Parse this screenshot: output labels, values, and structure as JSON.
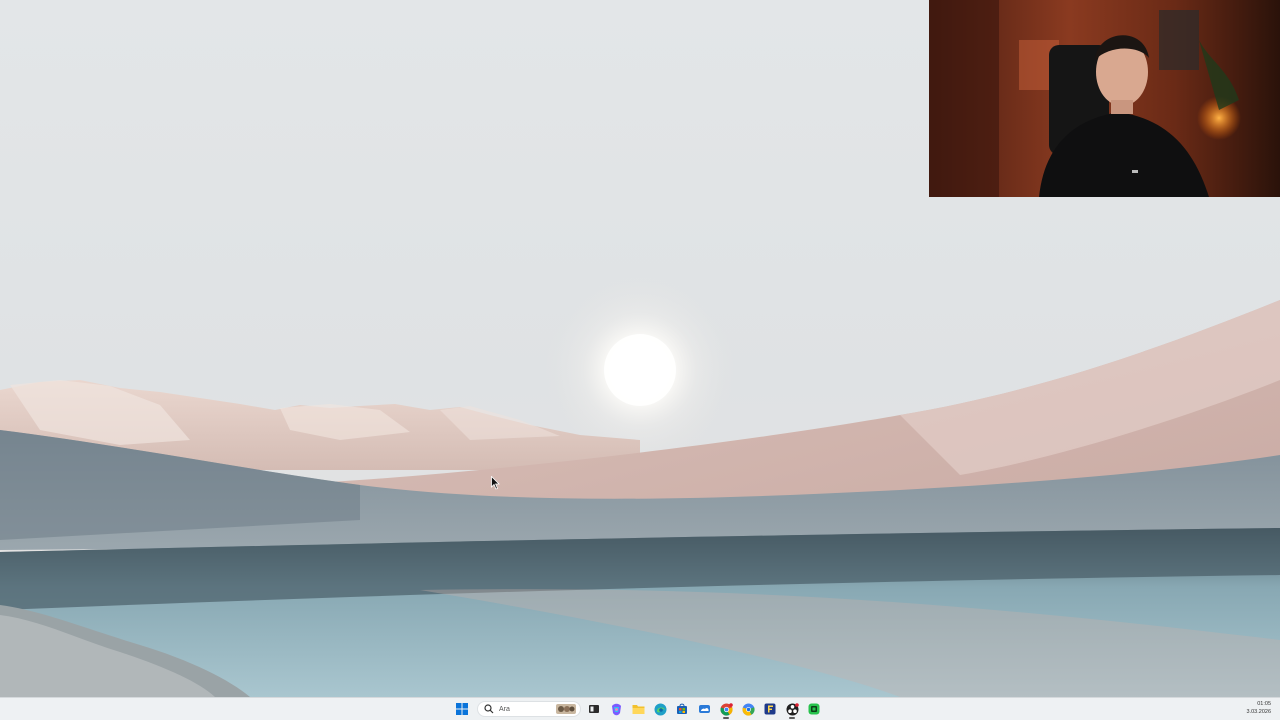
{
  "desktop": {
    "wallpaper": "desert-dunes-lake-wallpaper"
  },
  "webcam": {
    "content": "presenter-webcam-overlay"
  },
  "taskbar": {
    "start_icon": "windows-start-icon",
    "search": {
      "placeholder": "Ara",
      "icon": "search-icon"
    },
    "apps": [
      {
        "name": "task-view-icon",
        "color": "#2b2b2b"
      },
      {
        "name": "copilot-icon",
        "color": "#7b5cff"
      },
      {
        "name": "file-explorer-icon",
        "color": "#f2c12e"
      },
      {
        "name": "edge-icon",
        "color": "#1fa0c8"
      },
      {
        "name": "store-icon",
        "color": "#1a5fb4"
      },
      {
        "name": "onedrive-icon",
        "color": "#2a7ad8"
      },
      {
        "name": "chrome-icon",
        "color": "#db4437"
      },
      {
        "name": "chrome-profile-icon",
        "color": "#4285f4"
      },
      {
        "name": "app-f-icon",
        "color": "#1e3a8a"
      },
      {
        "name": "obs-icon",
        "color": "#202020"
      },
      {
        "name": "green-app-icon",
        "color": "#27c24c"
      }
    ],
    "clock": {
      "time": "01:05",
      "date": "3.03.2026"
    }
  },
  "colors": {
    "taskbar_bg": "#eef1f3",
    "accent": "#0a74da"
  }
}
